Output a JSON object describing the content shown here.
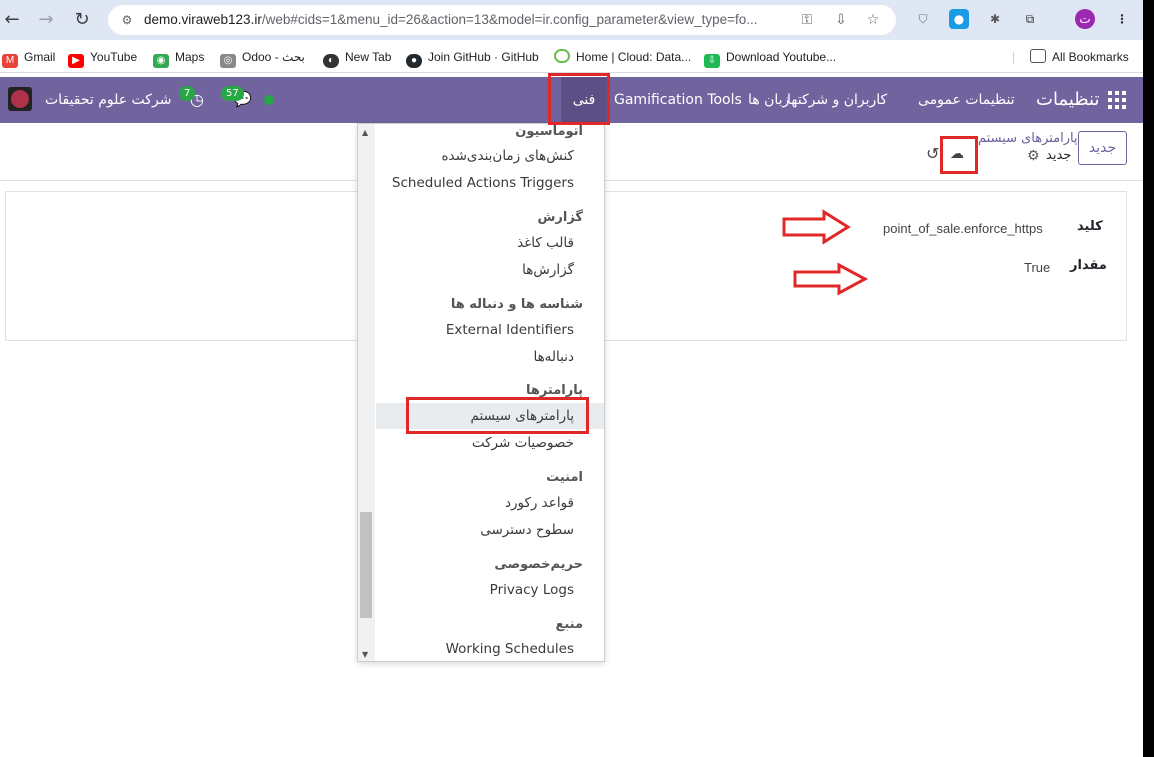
{
  "browser": {
    "url_host": "demo.viraweb123.ir",
    "url_rest": "/web#cids=1&menu_id=26&action=13&model=ir.config_parameter&view_type=fo...",
    "profile_initial": "ت",
    "bookmarks": [
      "Gmail",
      "YouTube",
      "Maps",
      "Odoo - بحث",
      "New Tab",
      "Join GitHub · GitHub",
      "Home | Cloud: Data...",
      "Download Youtube..."
    ],
    "all_bookmarks": "All Bookmarks"
  },
  "navbar": {
    "app_title": "تنظیمات",
    "menus": [
      "تنظیمات عمومی",
      "کاربران و شرکتها",
      "زبان ها",
      "Gamification Tools",
      "فنی"
    ],
    "company": "شرکت علوم تحقیقات",
    "activity_count": "7",
    "message_count": "57",
    "status_color": "#28a745",
    "brand_color": "#71639e"
  },
  "control_panel": {
    "new_button": "جدید",
    "breadcrumb": "پارامترهای سیستم",
    "record_name": "جدید"
  },
  "form": {
    "key_label": "کلید",
    "key_value": "point_of_sale.enforce_https",
    "value_label": "مقدار",
    "value_value": "True"
  },
  "dropdown": {
    "sections": [
      {
        "header": "اتوماسیون",
        "items": [
          "کنش‌های زمان‌بندی‌شده",
          "Scheduled Actions Triggers"
        ]
      },
      {
        "header": "گزارش",
        "items": [
          "قالب کاغذ",
          "گزارش‌ها"
        ]
      },
      {
        "header": "شناسه ها و دنباله ها",
        "items": [
          "External Identifiers",
          "دنباله‌ها"
        ]
      },
      {
        "header": "پارامترها",
        "items": [
          "پارامترهای سیستم",
          "خصوصیات شرکت"
        ]
      },
      {
        "header": "امنیت",
        "items": [
          "قواعد رکورد",
          "سطوح دسترسی"
        ]
      },
      {
        "header": "حریم‌خصوصی",
        "items": [
          "Privacy Logs"
        ]
      },
      {
        "header": "منبع",
        "items": [
          "Working Schedules"
        ]
      }
    ],
    "active_item": "پارامترهای سیستم"
  },
  "annotation_color": "#e02828"
}
